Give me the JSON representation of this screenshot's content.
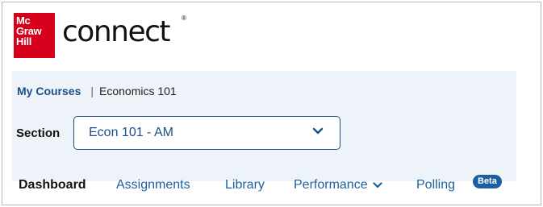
{
  "brand": {
    "logo_lines": [
      "Mc",
      "Graw",
      "Hill"
    ],
    "wordmark": "connect",
    "registered_mark": "®",
    "logo_color": "#d6001c"
  },
  "breadcrumb": {
    "link_label": "My Courses",
    "separator": "|",
    "current": "Economics 101"
  },
  "section": {
    "label": "Section",
    "selected_value": "Econ 101 - AM",
    "chevron_icon": "chevron-down-icon"
  },
  "nav": {
    "items": [
      {
        "label": "Dashboard",
        "active": true
      },
      {
        "label": "Assignments"
      },
      {
        "label": "Library"
      },
      {
        "label": "Performance",
        "has_dropdown": true
      },
      {
        "label": "Polling",
        "badge": "Beta"
      }
    ]
  },
  "colors": {
    "accent": "#1c4f86",
    "link": "#1c5fa0",
    "panel_bg": "#eef3f9"
  }
}
